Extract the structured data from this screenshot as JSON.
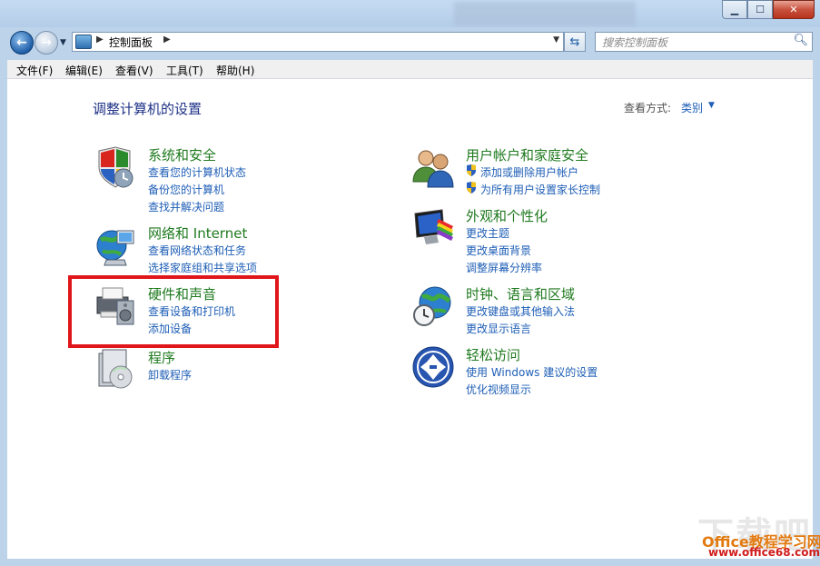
{
  "window": {
    "min_icon": "minimize-icon",
    "max_icon": "maximize-icon",
    "close_icon": "close-icon"
  },
  "address": {
    "path": "控制面板",
    "search_placeholder": "搜索控制面板"
  },
  "menu": [
    "文件(F)",
    "编辑(E)",
    "查看(V)",
    "工具(T)",
    "帮助(H)"
  ],
  "main": {
    "title": "调整计算机的设置",
    "view_by_label": "查看方式:",
    "view_by_value": "类别"
  },
  "categories": [
    {
      "title": "系统和安全",
      "links": [
        "查看您的计算机状态",
        "备份您的计算机",
        "查找并解决问题"
      ]
    },
    {
      "title": "网络和 Internet",
      "links": [
        "查看网络状态和任务",
        "选择家庭组和共享选项"
      ]
    },
    {
      "title": "硬件和声音",
      "links": [
        "查看设备和打印机",
        "添加设备"
      ]
    },
    {
      "title": "程序",
      "links": [
        "卸载程序"
      ]
    },
    {
      "title": "用户帐户和家庭安全",
      "links": [
        "添加或删除用户帐户",
        "为所有用户设置家长控制"
      ]
    },
    {
      "title": "外观和个性化",
      "links": [
        "更改主题",
        "更改桌面背景",
        "调整屏幕分辨率"
      ]
    },
    {
      "title": "时钟、语言和区域",
      "links": [
        "更改键盘或其他输入法",
        "更改显示语言"
      ]
    },
    {
      "title": "轻松访问",
      "links": [
        "使用 Windows 建议的设置",
        "优化视频显示"
      ]
    }
  ],
  "watermark": {
    "big": "下载吧",
    "office": "Office教程学习网",
    "url": "www.office68.com"
  },
  "colors": {
    "accent": "#1e5eb6",
    "category_title": "#1f7a1f",
    "highlight": "#e0161b"
  }
}
